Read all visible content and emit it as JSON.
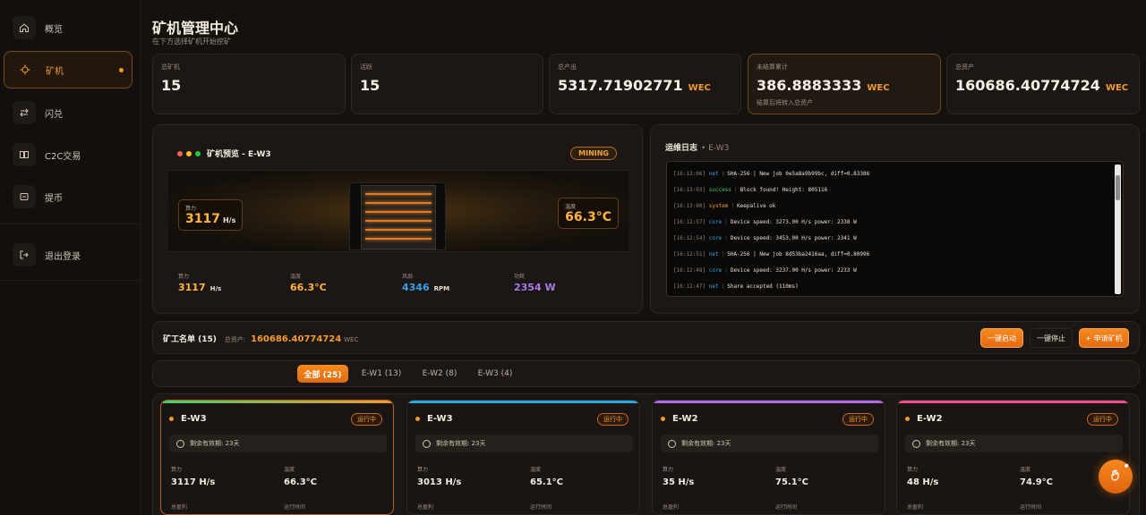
{
  "sidebar": {
    "items": [
      {
        "label": "概览",
        "icon": "home-icon"
      },
      {
        "label": "矿机",
        "icon": "crosshair-icon"
      },
      {
        "label": "闪兑",
        "icon": "swap-icon"
      },
      {
        "label": "C2C交易",
        "icon": "columns-icon"
      },
      {
        "label": "提币",
        "icon": "wallet-icon"
      }
    ],
    "logout": {
      "label": "退出登录",
      "icon": "logout-icon"
    }
  },
  "header": {
    "title": "矿机管理中心",
    "subtitle": "在下方选择矿机开始挖矿"
  },
  "stats": [
    {
      "label": "总矿机",
      "value": "15",
      "unit": "",
      "note": ""
    },
    {
      "label": "活跃",
      "value": "15",
      "unit": "",
      "note": ""
    },
    {
      "label": "总产出",
      "value": "5317.71902771",
      "unit": "WEC",
      "note": ""
    },
    {
      "label": "未结算累计",
      "value": "386.8883333",
      "unit": "WEC",
      "note": "结算后将转入总资产"
    },
    {
      "label": "总资产",
      "value": "160686.40774724",
      "unit": "WEC",
      "note": ""
    }
  ],
  "preview": {
    "title": "矿机预览 - E-W3",
    "status": "MINING",
    "overlay_left": {
      "label": "算力",
      "value": "3117",
      "unit": "H/s"
    },
    "overlay_right": {
      "label": "温度",
      "value": "66.3°C"
    },
    "metrics": [
      {
        "label": "算力",
        "value": "3117",
        "unit": "H/s",
        "color": "#ffb53c"
      },
      {
        "label": "温度",
        "value": "66.3°C",
        "unit": "",
        "color": "#ffb53c"
      },
      {
        "label": "风扇",
        "value": "4346",
        "unit": "RPM",
        "color": "#3aa0e8"
      },
      {
        "label": "功耗",
        "value": "2354 W",
        "unit": "",
        "color": "#a77be8"
      }
    ]
  },
  "log": {
    "title": "运维日志",
    "device": "• E-W3",
    "lines": [
      {
        "time": "[16:13:06]",
        "tag": "net",
        "color": "#3aa0e8",
        "msg": "SHA-256 | New job 0e5a8a9b99bc, diff=0.83386"
      },
      {
        "time": "[16:13:03]",
        "tag": "success",
        "color": "#3fcf6a",
        "msg": "Block found! Height: 805116"
      },
      {
        "time": "[16:13:00]",
        "tag": "system",
        "color": "#f39a2c",
        "msg": "Keepalive ok"
      },
      {
        "time": "[16:12:57]",
        "tag": "core",
        "color": "#3aa0e8",
        "msg": "Device speed: 3273.00 H/s power: 2338 W"
      },
      {
        "time": "[16:12:54]",
        "tag": "core",
        "color": "#3aa0e8",
        "msg": "Device speed: 3453.00 H/s power: 2341 W"
      },
      {
        "time": "[16:12:51]",
        "tag": "net",
        "color": "#3aa0e8",
        "msg": "SHA-256 | New job 8d53ba2416aa, diff=0.80996"
      },
      {
        "time": "[16:12:48]",
        "tag": "core",
        "color": "#3aa0e8",
        "msg": "Device speed: 3237.00 H/s power: 2233 W"
      },
      {
        "time": "[16:12:47]",
        "tag": "net",
        "color": "#3aa0e8",
        "msg": "Share accepted (110ms)"
      }
    ]
  },
  "miners": {
    "title": "矿工名单 (15)",
    "asset_label": "总资产:",
    "asset_value": "160686.40774724",
    "asset_unit": "WEC",
    "buttons": {
      "start_all": "一键启动",
      "stop_all": "一键停止",
      "apply": "+ 申请矿机"
    },
    "tabs": [
      "全部 (25)",
      "E-W1 (13)",
      "E-W2 (8)",
      "E-W3 (4)"
    ],
    "cards": [
      {
        "name": "E-W3",
        "status": "运行中",
        "expiry": "剩余有效期: 23天",
        "hash_label": "算力",
        "hash": "3117 H/s",
        "temp_label": "温度",
        "temp": "66.3°C",
        "profit_label": "总盈利",
        "runtime_label": "运行时间",
        "bar_color": "#3fcf6a"
      },
      {
        "name": "E-W3",
        "status": "运行中",
        "expiry": "剩余有效期: 23天",
        "hash_label": "算力",
        "hash": "3013 H/s",
        "temp_label": "温度",
        "temp": "65.1°C",
        "profit_label": "总盈利",
        "runtime_label": "运行时间",
        "bar_color": "#2aa7e0"
      },
      {
        "name": "E-W2",
        "status": "运行中",
        "expiry": "剩余有效期: 23天",
        "hash_label": "算力",
        "hash": "35 H/s",
        "temp_label": "温度",
        "temp": "75.1°C",
        "profit_label": "总盈利",
        "runtime_label": "运行时间",
        "bar_color": "#b06ae8"
      },
      {
        "name": "E-W2",
        "status": "运行中",
        "expiry": "剩余有效期: 23天",
        "hash_label": "算力",
        "hash": "48 H/s",
        "temp_label": "温度",
        "temp": "74.9°C",
        "profit_label": "总盈利",
        "runtime_label": "运行时间",
        "bar_color": "#f0508a"
      }
    ]
  },
  "fab": {
    "icon": "support-icon"
  }
}
